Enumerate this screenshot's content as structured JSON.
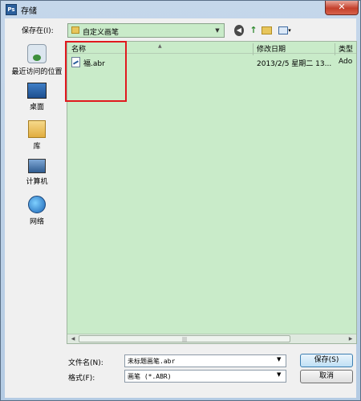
{
  "window": {
    "title": "存储",
    "app_icon_text": "Ps",
    "close_label": "✕"
  },
  "toolbar": {
    "save_in_label": "保存在(I):",
    "current_folder": "自定义画笔"
  },
  "places": [
    {
      "label": "最近访问的位置",
      "icon": "recent-places-icon"
    },
    {
      "label": "桌面",
      "icon": "desktop-icon"
    },
    {
      "label": "库",
      "icon": "library-icon"
    },
    {
      "label": "计算机",
      "icon": "computer-icon"
    },
    {
      "label": "网络",
      "icon": "network-icon"
    }
  ],
  "file_list": {
    "columns": [
      "名称",
      "修改日期",
      "类型"
    ],
    "rows": [
      {
        "name": "福.abr",
        "modified": "2013/2/5 星期二 13...",
        "type": "Ado"
      }
    ]
  },
  "form": {
    "filename_label": "文件名(N):",
    "filename_value": "未标题画笔.abr",
    "format_label": "格式(F):",
    "format_value": "画笔 (*.ABR)"
  },
  "buttons": {
    "save": "保存(S)",
    "cancel": "取消"
  },
  "colors": {
    "list_background": "#c9ebc9",
    "highlight": "#e0191e",
    "titlebar": "#b4cbe3"
  }
}
